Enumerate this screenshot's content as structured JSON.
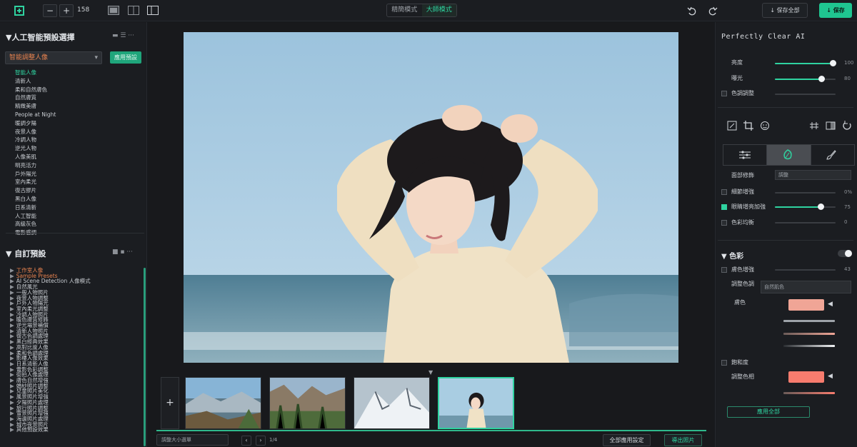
{
  "toolbar": {
    "zoom_out": "−",
    "zoom_in": "+",
    "zoom_value": "158",
    "modes": [
      "精簡模式",
      "大師模式"
    ],
    "active_mode": 1,
    "save_all_label": "↓ 保存全部",
    "save_label": "↓ 保存"
  },
  "left": {
    "preset_title": "▼人工智能預設選擇",
    "preset_select": "智能調整人像",
    "apply_label": "應用預設",
    "presets": [
      "智能人像",
      "清新人",
      "柔和自然膚色",
      "自然膚質",
      "精緻美膚",
      "People at Night",
      "暖調夕陽",
      "夜景人像",
      "冷調人物",
      "逆光人物",
      "人像美肌",
      "明亮活力",
      "戶外陽光",
      "室內柔光",
      "復古膠片",
      "黑白人像",
      "日系清新",
      "人工智能",
      "高級灰色",
      "電影感調"
    ],
    "custom_title": "▼ 自訂預設",
    "tree": [
      "工作室人像",
      "Sample Presets",
      "AI Scene Detection 人像模式",
      "自然風光",
      "一般人物照片",
      "夜景人物調整",
      "戶外人物陽光",
      "室內柔光調整",
      "冷調人物照片",
      "暖色膚質修飾",
      "逆光場景補償",
      "清新人物照片",
      "復古色調處理",
      "黑白經典效果",
      "高對比度人像",
      "柔和色調處理",
      "影樓人像效果",
      "日系清新人像",
      "電影色彩調整",
      "街拍人像處理",
      "膚色自然增強",
      "婚紗照片調整",
      "兒童照片美化",
      "風景照片增強",
      "夕陽照片處理",
      "旅行照片調整",
      "雪景照片增強",
      "海邊照片處理",
      "城市夜景照片",
      "其他預設效果"
    ]
  },
  "center": {
    "film_add": "+",
    "film_arrow": "▼",
    "size_select": "調整大小選單",
    "page_prev": "‹",
    "page_next": "›",
    "page_info": "1/4",
    "batch_label": "全部應用設定",
    "export_label": "導出照片"
  },
  "right": {
    "title": "Perfectly Clear AI",
    "sliders1": [
      {
        "label": "亮度",
        "value": "100",
        "level": 0.95
      },
      {
        "label": "曝光",
        "value": "80",
        "level": 0.76
      }
    ],
    "check1_label": "色調調整",
    "tab_select": "調整",
    "adjust_rows": [
      {
        "label": "面部修飾",
        "value": "",
        "level": 0.0,
        "checked": false,
        "type": "select"
      },
      {
        "label": "細節增強",
        "value": "0%",
        "level": 0.0,
        "checked": false,
        "type": "slider"
      },
      {
        "label": "眼睛增亮加強",
        "value": "75",
        "level": 0.75,
        "checked": true,
        "type": "slider"
      },
      {
        "label": "色彩均衡",
        "value": "0",
        "level": 0.0,
        "checked": false,
        "type": "slider"
      }
    ],
    "section2_title": "▼ 色彩",
    "section2_rows": [
      {
        "label": "膚色增強",
        "value": "43"
      },
      {
        "label": "調整色調",
        "value": ""
      }
    ],
    "tone_select": "自然肌色",
    "swatch_label": "膚色",
    "swatch_color": "#f0a596",
    "swatch2_color": "#f77c6e",
    "color_label": "飽和度",
    "color_check": "調整色相",
    "final_label": "應用全部"
  }
}
